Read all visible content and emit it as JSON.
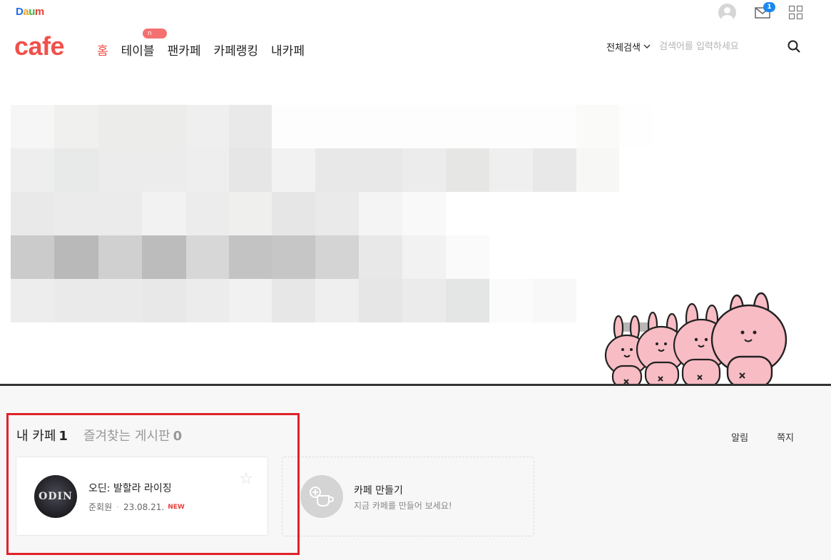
{
  "header": {
    "daum_logo": [
      "D",
      "a",
      "u",
      "m"
    ],
    "cafe_logo": "cafe",
    "nav": [
      {
        "label": "홈",
        "active": true
      },
      {
        "label": "테이블",
        "active": false
      },
      {
        "label": "팬카페",
        "active": false
      },
      {
        "label": "카페랭킹",
        "active": false
      },
      {
        "label": "내카페",
        "active": false
      }
    ],
    "new_badge": "n",
    "mail_count": "1",
    "search": {
      "scope_label": "전체검색",
      "placeholder": "검색어를 입력하세요"
    }
  },
  "tabs": {
    "my_cafe": {
      "label": "내 카페",
      "count": "1"
    },
    "fav_board": {
      "label": "즐겨찾는 게시판",
      "count": "0"
    }
  },
  "right_links": {
    "alerts": "알림",
    "messages": "쪽지"
  },
  "cafe_card": {
    "name": "오딘: 발할라 라이징",
    "grade": "준회원",
    "date": "23.08.21.",
    "new_label": "NEW",
    "thumb_text": "ODIN"
  },
  "make_card": {
    "title": "카페 만들기",
    "subtitle": "지금 카페를 만들어 보세요!"
  },
  "colors": {
    "brand": "#f0504b",
    "highlight": "#e0212b",
    "mail_badge": "#1a88f0"
  },
  "icons": [
    "avatar-icon",
    "mail-icon",
    "apps-grid-icon",
    "chevron-down-icon",
    "search-icon",
    "star-icon",
    "cup-plus-icon"
  ]
}
